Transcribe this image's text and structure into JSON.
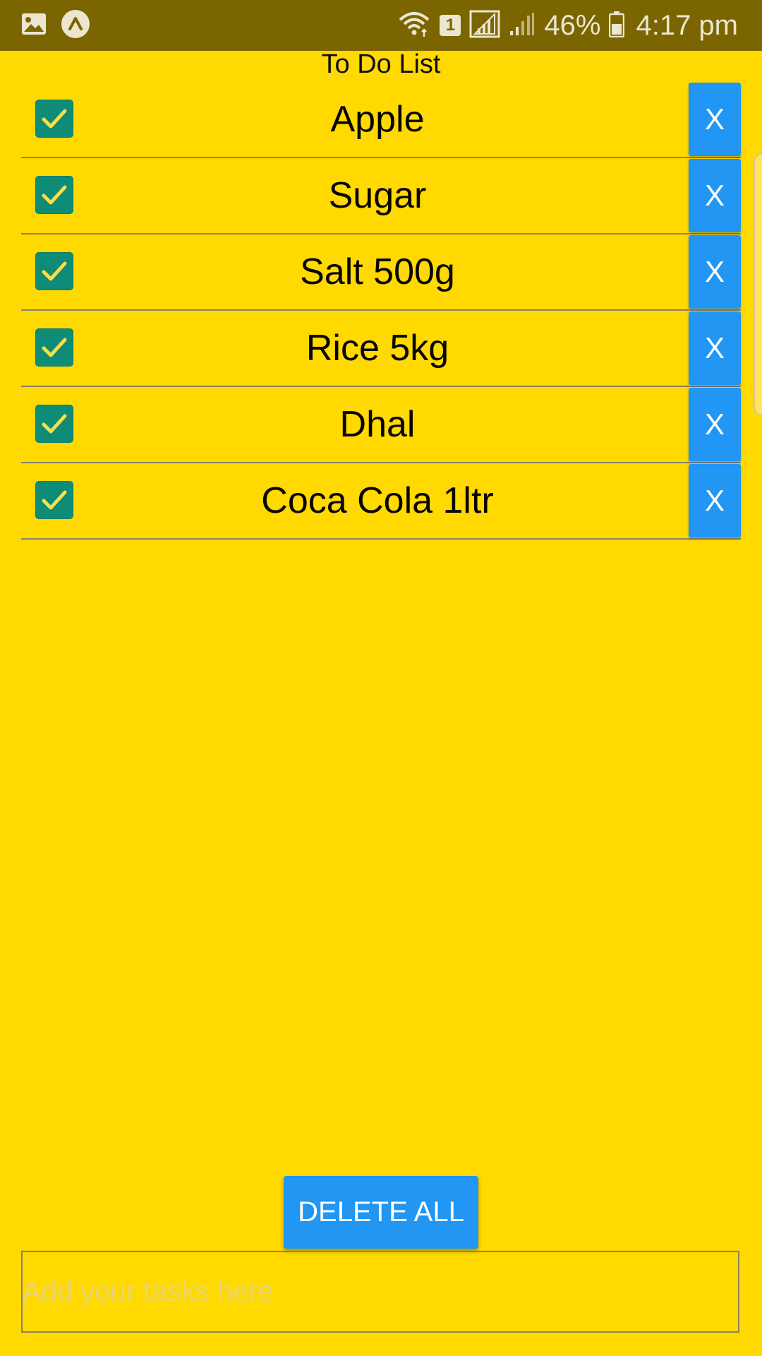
{
  "status_bar": {
    "battery_percent": "46%",
    "time": "4:17 pm",
    "sim_slot": "1",
    "icons": [
      "gallery-icon",
      "app-icon",
      "wifi-icon",
      "sim-icon",
      "signal-icon",
      "signal-icon",
      "battery-icon"
    ]
  },
  "app": {
    "title": "To Do List"
  },
  "tasks": [
    {
      "label": "Apple",
      "checked": true,
      "remove_label": "X"
    },
    {
      "label": "Sugar",
      "checked": true,
      "remove_label": "X"
    },
    {
      "label": "Salt 500g",
      "checked": true,
      "remove_label": "X"
    },
    {
      "label": "Rice 5kg",
      "checked": true,
      "remove_label": "X"
    },
    {
      "label": "Dhal",
      "checked": true,
      "remove_label": "X"
    },
    {
      "label": "Coca Cola 1ltr",
      "checked": true,
      "remove_label": "X"
    }
  ],
  "actions": {
    "delete_all_label": "DELETE ALL"
  },
  "input": {
    "placeholder": "Add your tasks here",
    "value": ""
  },
  "colors": {
    "background": "#FFD900",
    "status_bar": "#7A6500",
    "button": "#2196F3",
    "checkbox": "#0E8C77",
    "checkmark": "#F5E04A"
  }
}
